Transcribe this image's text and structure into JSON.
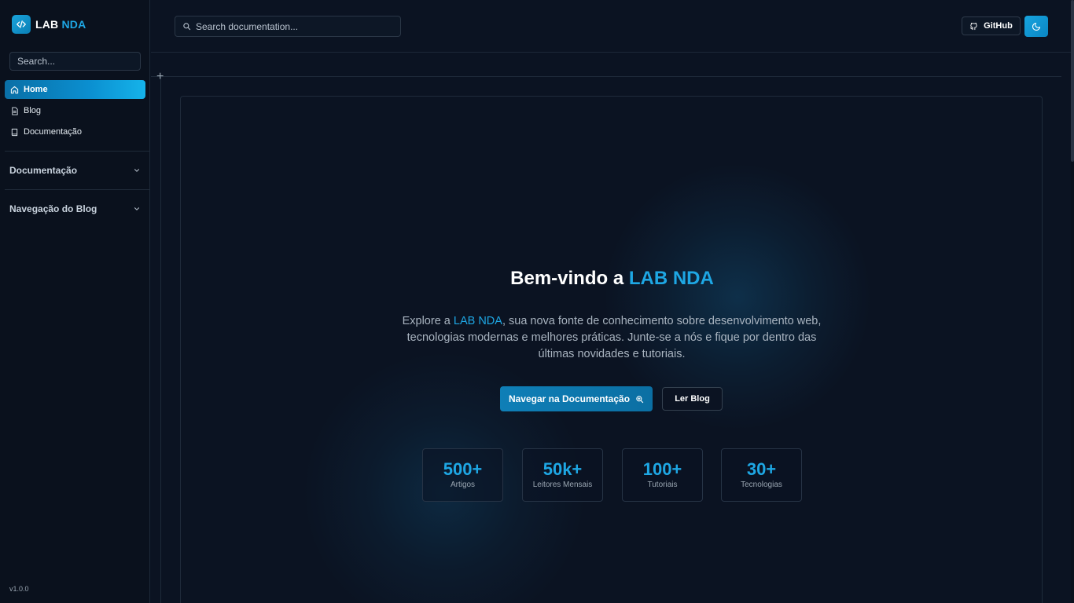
{
  "brand": {
    "name_part1": "LAB",
    "name_part2": "NDA",
    "logo_icon": "code-icon"
  },
  "sidebar": {
    "search_placeholder": "Search...",
    "nav": [
      {
        "label": "Home",
        "icon": "home-icon",
        "active": true
      },
      {
        "label": "Blog",
        "icon": "document-icon",
        "active": false
      },
      {
        "label": "Documentação",
        "icon": "book-icon",
        "active": false
      }
    ],
    "sections": [
      {
        "label": "Documentação",
        "icon": "chevron-down-icon"
      },
      {
        "label": "Navegação do Blog",
        "icon": "chevron-down-icon"
      }
    ],
    "version": "v1.0.0"
  },
  "topbar": {
    "search_placeholder": "Search documentation...",
    "github_label": "GitHub",
    "theme_icon": "moon-icon"
  },
  "hero": {
    "title_prefix": "Bem-vindo a ",
    "title_accent": "LAB NDA",
    "desc_prefix": "Explore a ",
    "desc_accent": "LAB NDA",
    "desc_rest": ", sua nova fonte de conhecimento sobre desenvolvimento web, tecnologias modernas e melhores práticas. Junte-se a nós e fique por dentro das últimas novidades e tutoriais.",
    "primary_button": "Navegar na Documentação",
    "secondary_button": "Ler Blog"
  },
  "stats": [
    {
      "value": "500+",
      "label": "Artigos"
    },
    {
      "value": "50k+",
      "label": "Leitores Mensais"
    },
    {
      "value": "100+",
      "label": "Tutoriais"
    },
    {
      "value": "30+",
      "label": "Tecnologias"
    }
  ],
  "colors": {
    "accent": "#1ea7e4",
    "background": "#0b1322",
    "sidebar": "#0a111d"
  }
}
